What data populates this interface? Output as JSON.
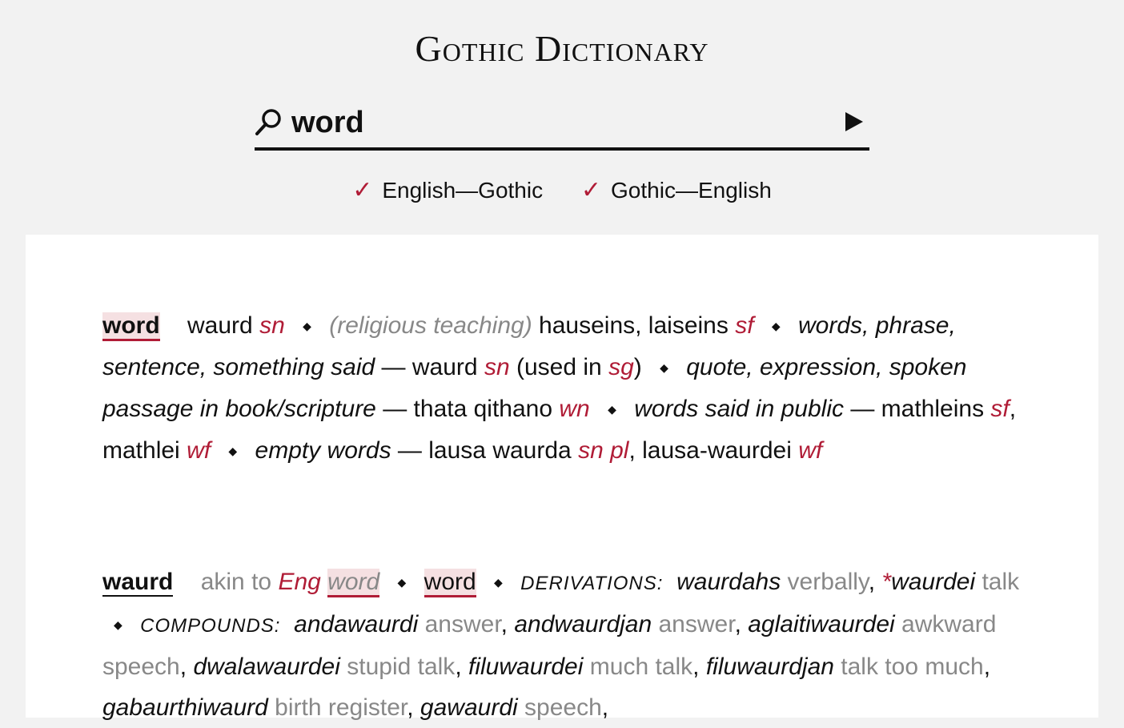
{
  "app": {
    "title": "Gothic Dictionary"
  },
  "search": {
    "value": "word"
  },
  "directions": [
    {
      "check": "✓",
      "label": "English—Gothic"
    },
    {
      "check": "✓",
      "label": "Gothic—English"
    }
  ],
  "entry1": {
    "headword": "word",
    "t1": "waurd",
    "t1g": "sn",
    "t2note": "(religious teaching)",
    "t2": "hauseins, laiseins",
    "t2g": "sf",
    "t3e": "words, phrase, sentence, something said",
    "t3": "waurd",
    "t3g": "sn",
    "t3p1": "(used in",
    "t3p2": "sg",
    "t3p3": ")",
    "t4e": "quote, expression, spoken passage in book/scripture",
    "t4": "thata qithano",
    "t4g": "wn",
    "t5e": "words said in public",
    "t5a": "mathleins",
    "t5ag": "sf",
    "t5b": "mathlei",
    "t5bg": "wf",
    "t6e": "empty words",
    "t6a": "lausa waurda",
    "t6ag": "sn pl",
    "t6b": "lausa-waurdei",
    "t6bg": "wf"
  },
  "entry2": {
    "headword": "waurd",
    "akin": "akin to",
    "eng": "Eng",
    "engword": "word",
    "meaning": "word",
    "derivations_label": "DERIVATIONS:",
    "derivations": [
      {
        "word": "waurdahs",
        "gloss": "verbally",
        "sep": ","
      },
      {
        "star": "*",
        "word": "waurdei",
        "gloss": "talk",
        "sep": ""
      }
    ],
    "compounds_label": "COMPOUNDS:",
    "compounds": [
      {
        "word": "andawaurdi",
        "gloss": "answer",
        "sep": ","
      },
      {
        "word": "andwaurdjan",
        "gloss": "answer",
        "sep": ","
      },
      {
        "word": "aglaitiwaurdei",
        "gloss": "awkward speech",
        "sep": ","
      },
      {
        "word": "dwalawaurdei",
        "gloss": "stupid talk",
        "sep": ","
      },
      {
        "word": "filuwaurdei",
        "gloss": "much talk",
        "sep": ","
      },
      {
        "word": "filuwaurdjan",
        "gloss": "talk too much",
        "sep": ","
      },
      {
        "word": "gabaurthiwaurd",
        "gloss": "birth register",
        "sep": ","
      },
      {
        "word": "gawaurdi",
        "gloss": "speech",
        "sep": ","
      }
    ]
  }
}
